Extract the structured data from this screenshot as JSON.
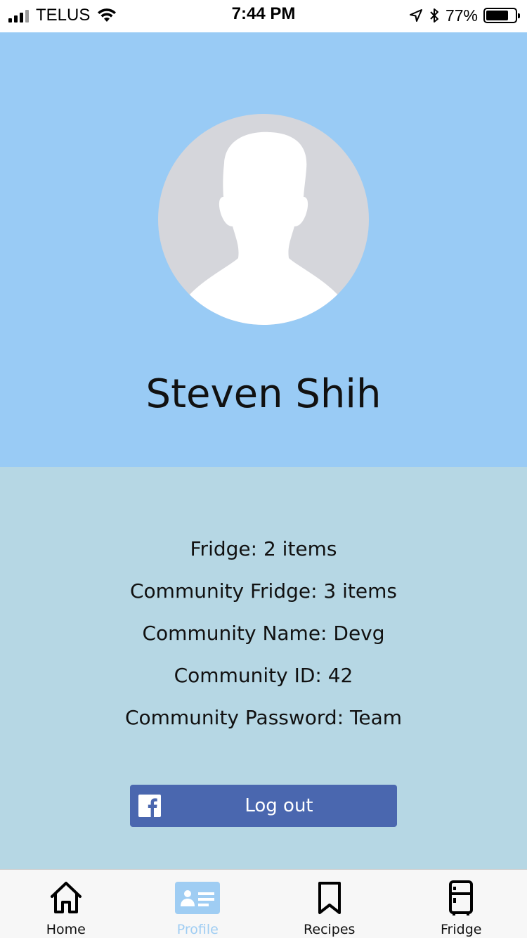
{
  "status_bar": {
    "carrier": "TELUS",
    "time": "7:44 PM",
    "battery_text": "77%",
    "battery_level": 0.77
  },
  "profile": {
    "name": "Steven Shih",
    "avatar_icon": "default-avatar-icon"
  },
  "info_lines": [
    "Fridge: 2 items",
    "Community Fridge: 3 items",
    "Community Name: Devg",
    "Community ID: 42",
    "Community Password: Team"
  ],
  "logout": {
    "label": "Log out",
    "icon": "facebook-icon",
    "color": "#4a67af"
  },
  "tabs": [
    {
      "label": "Home",
      "icon": "home-icon",
      "active": false
    },
    {
      "label": "Profile",
      "icon": "profile-card-icon",
      "active": true
    },
    {
      "label": "Recipes",
      "icon": "bookmark-icon",
      "active": false
    },
    {
      "label": "Fridge",
      "icon": "fridge-icon",
      "active": false
    }
  ],
  "colors": {
    "header_bg": "#99cbf5",
    "info_bg": "#b6d7e4",
    "active_tab": "#9fcdf3"
  }
}
